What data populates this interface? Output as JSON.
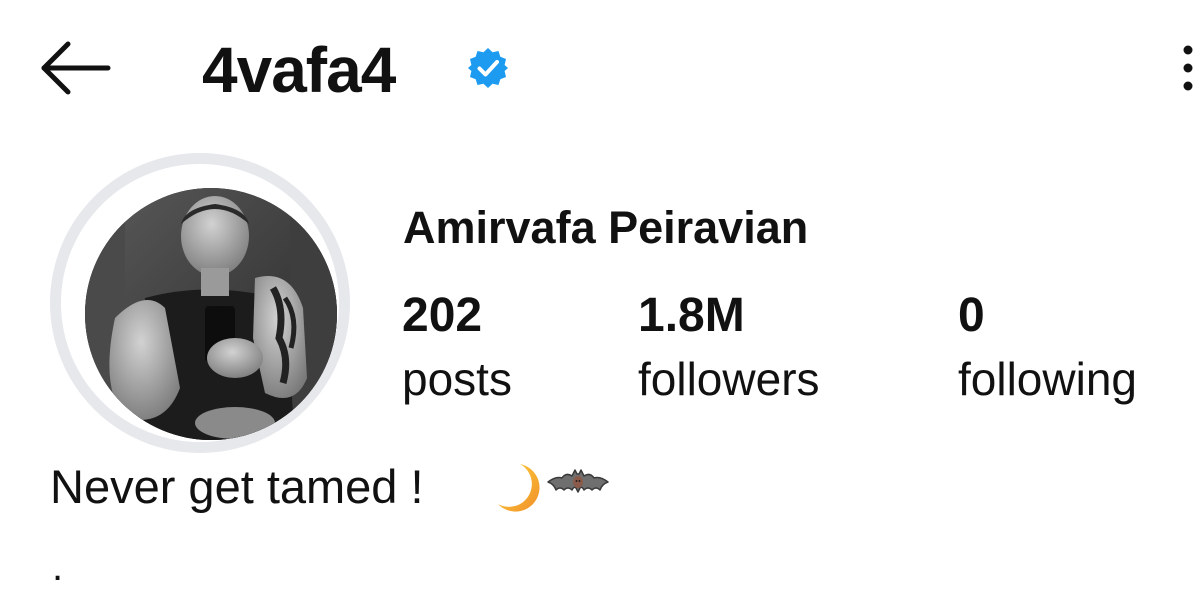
{
  "header": {
    "back_icon": "arrow-left-icon",
    "username": "4vafa4",
    "verified_icon": "verified-badge-icon",
    "verified_color": "#1D9BF0",
    "more_icon": "more-vertical-icon"
  },
  "profile": {
    "full_name": "Amirvafa Peiravian",
    "stats": {
      "posts": {
        "value": "202",
        "label": "posts"
      },
      "followers": {
        "value": "1.8M",
        "label": "followers"
      },
      "following": {
        "value": "0",
        "label": "following"
      }
    },
    "bio": "Never get tamed !",
    "bio_emojis": [
      "crescent-moon-icon",
      "bat-icon"
    ],
    "bio_extra_line": "."
  }
}
